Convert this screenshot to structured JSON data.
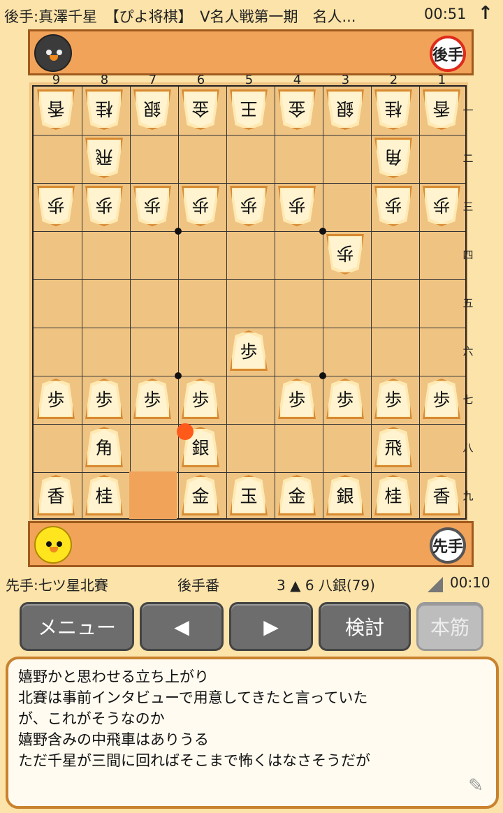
{
  "header": {
    "title": "後手:真澤千星　【ぴよ将棋】　V名人戦第一期　名人...",
    "clock": "00:51",
    "arrow_icon": "arrow-up-icon"
  },
  "gote_stand": {
    "badge": "後手",
    "avatar_icon": "black-chick-icon"
  },
  "sente_stand": {
    "badge": "先手",
    "avatar_icon": "yellow-chick-icon"
  },
  "board": {
    "files": [
      "9",
      "8",
      "7",
      "6",
      "5",
      "4",
      "3",
      "2",
      "1"
    ],
    "ranks": [
      "一",
      "二",
      "三",
      "四",
      "五",
      "六",
      "七",
      "八",
      "九"
    ],
    "last_move_from": {
      "file": 7,
      "rank": 9
    },
    "last_move_to": {
      "file": 6,
      "rank": 8
    },
    "pieces": [
      {
        "f": 9,
        "r": 1,
        "k": "香",
        "side": "gote"
      },
      {
        "f": 8,
        "r": 1,
        "k": "桂",
        "side": "gote"
      },
      {
        "f": 7,
        "r": 1,
        "k": "銀",
        "side": "gote"
      },
      {
        "f": 6,
        "r": 1,
        "k": "金",
        "side": "gote"
      },
      {
        "f": 5,
        "r": 1,
        "k": "王",
        "side": "gote"
      },
      {
        "f": 4,
        "r": 1,
        "k": "金",
        "side": "gote"
      },
      {
        "f": 3,
        "r": 1,
        "k": "銀",
        "side": "gote"
      },
      {
        "f": 2,
        "r": 1,
        "k": "桂",
        "side": "gote"
      },
      {
        "f": 1,
        "r": 1,
        "k": "香",
        "side": "gote"
      },
      {
        "f": 8,
        "r": 2,
        "k": "飛",
        "side": "gote"
      },
      {
        "f": 2,
        "r": 2,
        "k": "角",
        "side": "gote"
      },
      {
        "f": 9,
        "r": 3,
        "k": "歩",
        "side": "gote"
      },
      {
        "f": 8,
        "r": 3,
        "k": "歩",
        "side": "gote"
      },
      {
        "f": 7,
        "r": 3,
        "k": "歩",
        "side": "gote"
      },
      {
        "f": 6,
        "r": 3,
        "k": "歩",
        "side": "gote"
      },
      {
        "f": 5,
        "r": 3,
        "k": "歩",
        "side": "gote"
      },
      {
        "f": 4,
        "r": 3,
        "k": "歩",
        "side": "gote"
      },
      {
        "f": 2,
        "r": 3,
        "k": "歩",
        "side": "gote"
      },
      {
        "f": 1,
        "r": 3,
        "k": "歩",
        "side": "gote"
      },
      {
        "f": 3,
        "r": 4,
        "k": "歩",
        "side": "gote"
      },
      {
        "f": 5,
        "r": 6,
        "k": "歩",
        "side": "sente"
      },
      {
        "f": 9,
        "r": 7,
        "k": "歩",
        "side": "sente"
      },
      {
        "f": 8,
        "r": 7,
        "k": "歩",
        "side": "sente"
      },
      {
        "f": 7,
        "r": 7,
        "k": "歩",
        "side": "sente"
      },
      {
        "f": 6,
        "r": 7,
        "k": "歩",
        "side": "sente"
      },
      {
        "f": 4,
        "r": 7,
        "k": "歩",
        "side": "sente"
      },
      {
        "f": 3,
        "r": 7,
        "k": "歩",
        "side": "sente"
      },
      {
        "f": 2,
        "r": 7,
        "k": "歩",
        "side": "sente"
      },
      {
        "f": 1,
        "r": 7,
        "k": "歩",
        "side": "sente"
      },
      {
        "f": 8,
        "r": 8,
        "k": "角",
        "side": "sente"
      },
      {
        "f": 6,
        "r": 8,
        "k": "銀",
        "side": "sente"
      },
      {
        "f": 2,
        "r": 8,
        "k": "飛",
        "side": "sente"
      },
      {
        "f": 9,
        "r": 9,
        "k": "香",
        "side": "sente"
      },
      {
        "f": 8,
        "r": 9,
        "k": "桂",
        "side": "sente"
      },
      {
        "f": 6,
        "r": 9,
        "k": "金",
        "side": "sente"
      },
      {
        "f": 5,
        "r": 9,
        "k": "玉",
        "side": "sente"
      },
      {
        "f": 4,
        "r": 9,
        "k": "金",
        "side": "sente"
      },
      {
        "f": 3,
        "r": 9,
        "k": "銀",
        "side": "sente"
      },
      {
        "f": 2,
        "r": 9,
        "k": "桂",
        "side": "sente"
      },
      {
        "f": 1,
        "r": 9,
        "k": "香",
        "side": "sente"
      }
    ]
  },
  "status": {
    "sente_player": "先手:七ツ星北賽",
    "turn": "後手番",
    "last_move": "3 ▲ 6 八銀(79)",
    "clock": "00:10"
  },
  "buttons": {
    "menu": "メニュー",
    "prev": "◀",
    "next": "▶",
    "analyze": "検討",
    "mainline": "本筋"
  },
  "comment": {
    "lines": [
      "嬉野かと思わせる立ち上がり",
      "北賽は事前インタビューで用意してきたと言っていた",
      "が、これがそうなのか",
      "嬉野含みの中飛車はありうる",
      "ただ千星が三間に回ればそこまで怖くはなさそうだが"
    ],
    "edit_icon": "pencil-icon"
  }
}
